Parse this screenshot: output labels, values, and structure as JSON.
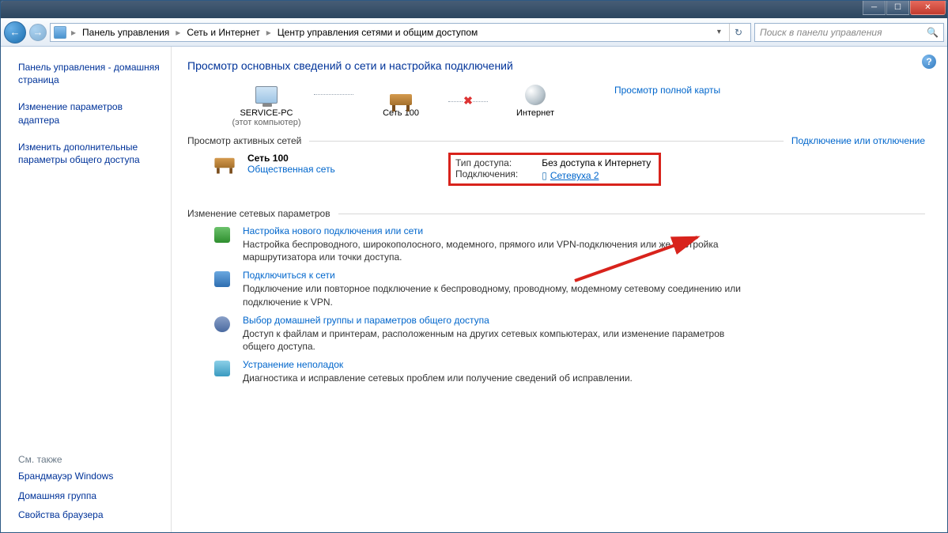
{
  "window": {
    "breadcrumbs": [
      "Панель управления",
      "Сеть и Интернет",
      "Центр управления сетями и общим доступом"
    ],
    "search_placeholder": "Поиск в панели управления"
  },
  "sidebar": {
    "links": [
      "Панель управления - домашняя страница",
      "Изменение параметров адаптера",
      "Изменить дополнительные параметры общего доступа"
    ],
    "see_also_label": "См. также",
    "see_also": [
      "Брандмауэр Windows",
      "Домашняя группа",
      "Свойства браузера"
    ]
  },
  "main": {
    "title": "Просмотр основных сведений о сети и настройка подключений",
    "map": {
      "nodes": [
        {
          "label": "SERVICE-PC",
          "sub": "(этот компьютер)"
        },
        {
          "label": "Сеть  100",
          "sub": ""
        },
        {
          "label": "Интернет",
          "sub": ""
        }
      ],
      "full_map_link": "Просмотр полной карты"
    },
    "active_networks": {
      "heading": "Просмотр активных сетей",
      "right_link": "Подключение или отключение",
      "network": {
        "name": "Сеть  100",
        "type": "Общественная сеть",
        "access_label": "Тип доступа:",
        "access_value": "Без доступа к Интернету",
        "connections_label": "Подключения:",
        "connection_link": "Сетевуха 2"
      }
    },
    "change_settings_heading": "Изменение сетевых параметров",
    "tasks": [
      {
        "title": "Настройка нового подключения или сети",
        "desc": "Настройка беспроводного, широкополосного, модемного, прямого или VPN-подключения или же настройка маршрутизатора или точки доступа."
      },
      {
        "title": "Подключиться к сети",
        "desc": "Подключение или повторное подключение к беспроводному, проводному, модемному сетевому соединению или подключение к VPN."
      },
      {
        "title": "Выбор домашней группы и параметров общего доступа",
        "desc": "Доступ к файлам и принтерам, расположенным на других сетевых компьютерах, или изменение параметров общего доступа."
      },
      {
        "title": "Устранение неполадок",
        "desc": "Диагностика и исправление сетевых проблем или получение сведений об исправлении."
      }
    ]
  }
}
